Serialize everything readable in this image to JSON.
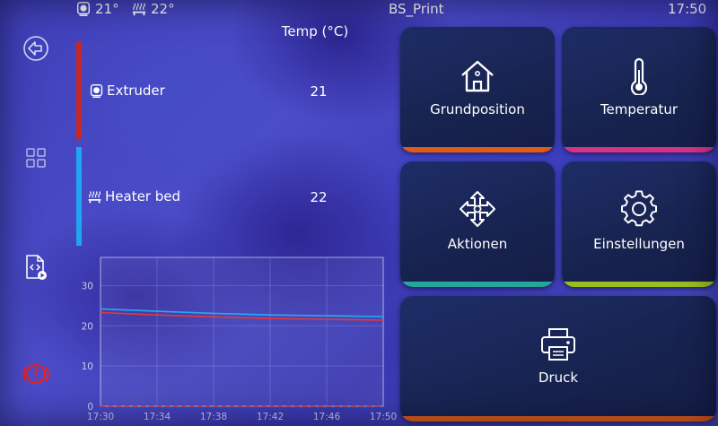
{
  "status": {
    "extruder_temp": "21°",
    "bed_temp": "22°",
    "printer_name": "BS_Print",
    "time": "17:50"
  },
  "sidebar": {
    "items": [
      {
        "icon": "back-arrow-icon"
      },
      {
        "icon": "grid-icon"
      },
      {
        "icon": "code-file-icon"
      },
      {
        "icon": "emergency-stop-icon"
      }
    ]
  },
  "temperatures": {
    "header": "Temp (°C)",
    "heaters": [
      {
        "name": "Extruder",
        "value": "21",
        "color": "#c62828",
        "icon": "extruder-icon"
      },
      {
        "name": "Heater bed",
        "value": "22",
        "color": "#1ea7f0",
        "icon": "heater-bed-icon"
      }
    ]
  },
  "chart_data": {
    "type": "line",
    "x_ticks": [
      "17:30",
      "17:34",
      "17:38",
      "17:42",
      "17:46",
      "17:50"
    ],
    "y_ticks": [
      "0",
      "10",
      "20",
      "30"
    ],
    "xlim": [
      "17:30",
      "17:50"
    ],
    "ylim": [
      0,
      37
    ],
    "grid": true,
    "series": [
      {
        "color": "#e53935",
        "x": [
          "17:30",
          "17:34",
          "17:38",
          "17:42",
          "17:46",
          "17:50"
        ],
        "values": [
          23.3,
          22.7,
          22.2,
          21.8,
          21.6,
          21.4
        ]
      },
      {
        "color": "#29a8f2",
        "x": [
          "17:30",
          "17:34",
          "17:38",
          "17:42",
          "17:46",
          "17:50"
        ],
        "values": [
          24.2,
          23.6,
          23.1,
          22.7,
          22.5,
          22.3
        ]
      },
      {
        "color": "#29a8f2",
        "x": [
          "17:30",
          "17:50"
        ],
        "values": [
          0,
          0
        ]
      },
      {
        "color": "#e53935",
        "x": [
          "17:30",
          "17:50"
        ],
        "values": [
          0,
          0
        ]
      }
    ]
  },
  "tiles": [
    {
      "label": "Grundposition",
      "icon": "home-icon",
      "accent": "#e05a1a"
    },
    {
      "label": "Temperatur",
      "icon": "thermometer-icon",
      "accent": "#d63384"
    },
    {
      "label": "Aktionen",
      "icon": "move-arrows-icon",
      "accent": "#26a69a"
    },
    {
      "label": "Einstellungen",
      "icon": "gear-icon",
      "accent": "#9bbf1a"
    },
    {
      "label": "Druck",
      "icon": "printer-icon",
      "accent": "#e05a1a"
    }
  ]
}
